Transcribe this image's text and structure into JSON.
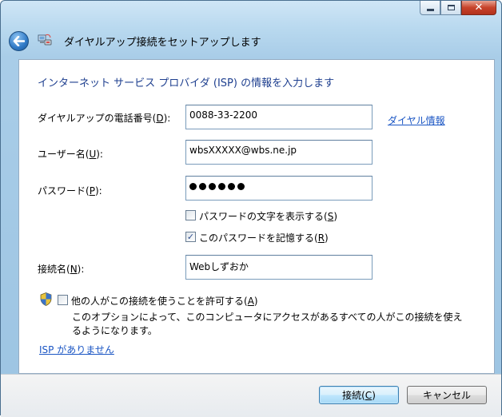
{
  "window": {
    "buttons": {
      "minimize": "minimize",
      "maximize": "maximize",
      "close": "close"
    }
  },
  "header": {
    "title": "ダイヤルアップ接続をセットアップします",
    "back_icon": "back-arrow-icon",
    "wizard_icon": "network-connection-icon"
  },
  "main": {
    "instruction": "インターネット サービス プロバイダ (ISP) の情報を入力します",
    "phone": {
      "label_pre": "ダイヤルアップの電話番号(",
      "accel": "D",
      "label_post": "):",
      "value": "0088-33-2200"
    },
    "dial_info_link": "ダイヤル情報",
    "username": {
      "label_pre": "ユーザー名(",
      "accel": "U",
      "label_post": "):",
      "value": "wbsXXXXX@wbs.ne.jp"
    },
    "password": {
      "label_pre": "パスワード(",
      "accel": "P",
      "label_post": "):",
      "masked_char_count": 6
    },
    "show_chars": {
      "label_pre": "パスワードの文字を表示する(",
      "accel": "S",
      "label_post": ")",
      "checked": false
    },
    "remember": {
      "label_pre": "このパスワードを記憶する(",
      "accel": "R",
      "label_post": ")",
      "checked": true
    },
    "connection_name": {
      "label_pre": "接続名(",
      "accel": "N",
      "label_post": "):",
      "value": "Webしずおか"
    },
    "allow_others": {
      "label_pre": "他の人がこの接続を使うことを許可する(",
      "accel": "A",
      "label_post": ")",
      "checked": false,
      "icon": "uac-shield-icon"
    },
    "description_line1": "このオプションによって、このコンピュータにアクセスがあるすべての人がこの接続を使え",
    "description_line2": "るようになります。",
    "no_isp_link": "ISP がありません"
  },
  "footer": {
    "connect": {
      "label_pre": "接続(",
      "accel": "C",
      "label_post": ")"
    },
    "cancel": "キャンセル"
  }
}
